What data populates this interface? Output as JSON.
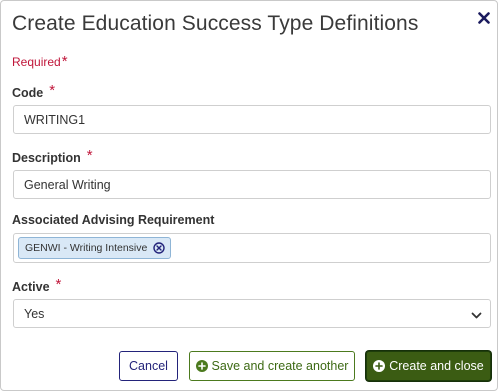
{
  "dialog": {
    "title": "Create Education Success Type Definitions",
    "close_icon": "close-icon",
    "required_note": "Required",
    "required_star": "*"
  },
  "form": {
    "code": {
      "label": "Code",
      "star": "*",
      "value": "WRITING1"
    },
    "description": {
      "label": "Description",
      "star": "*",
      "value": "General Writing"
    },
    "requirement": {
      "label": "Associated Advising Requirement",
      "tags": [
        {
          "label": "GENWI - Writing Intensive",
          "remove_icon": "remove-circle-icon"
        }
      ]
    },
    "active": {
      "label": "Active",
      "star": "*",
      "selected": "Yes",
      "icon": "chevron-down-icon"
    }
  },
  "buttons": {
    "cancel": "Cancel",
    "save_another": "Save and create another",
    "create_close": "Create and close"
  },
  "colors": {
    "required": "#c0163a",
    "cancel": "#23237a",
    "save": "#4c7a1e",
    "create": "#3b5c13",
    "tag_bg": "#d9e8f6"
  }
}
